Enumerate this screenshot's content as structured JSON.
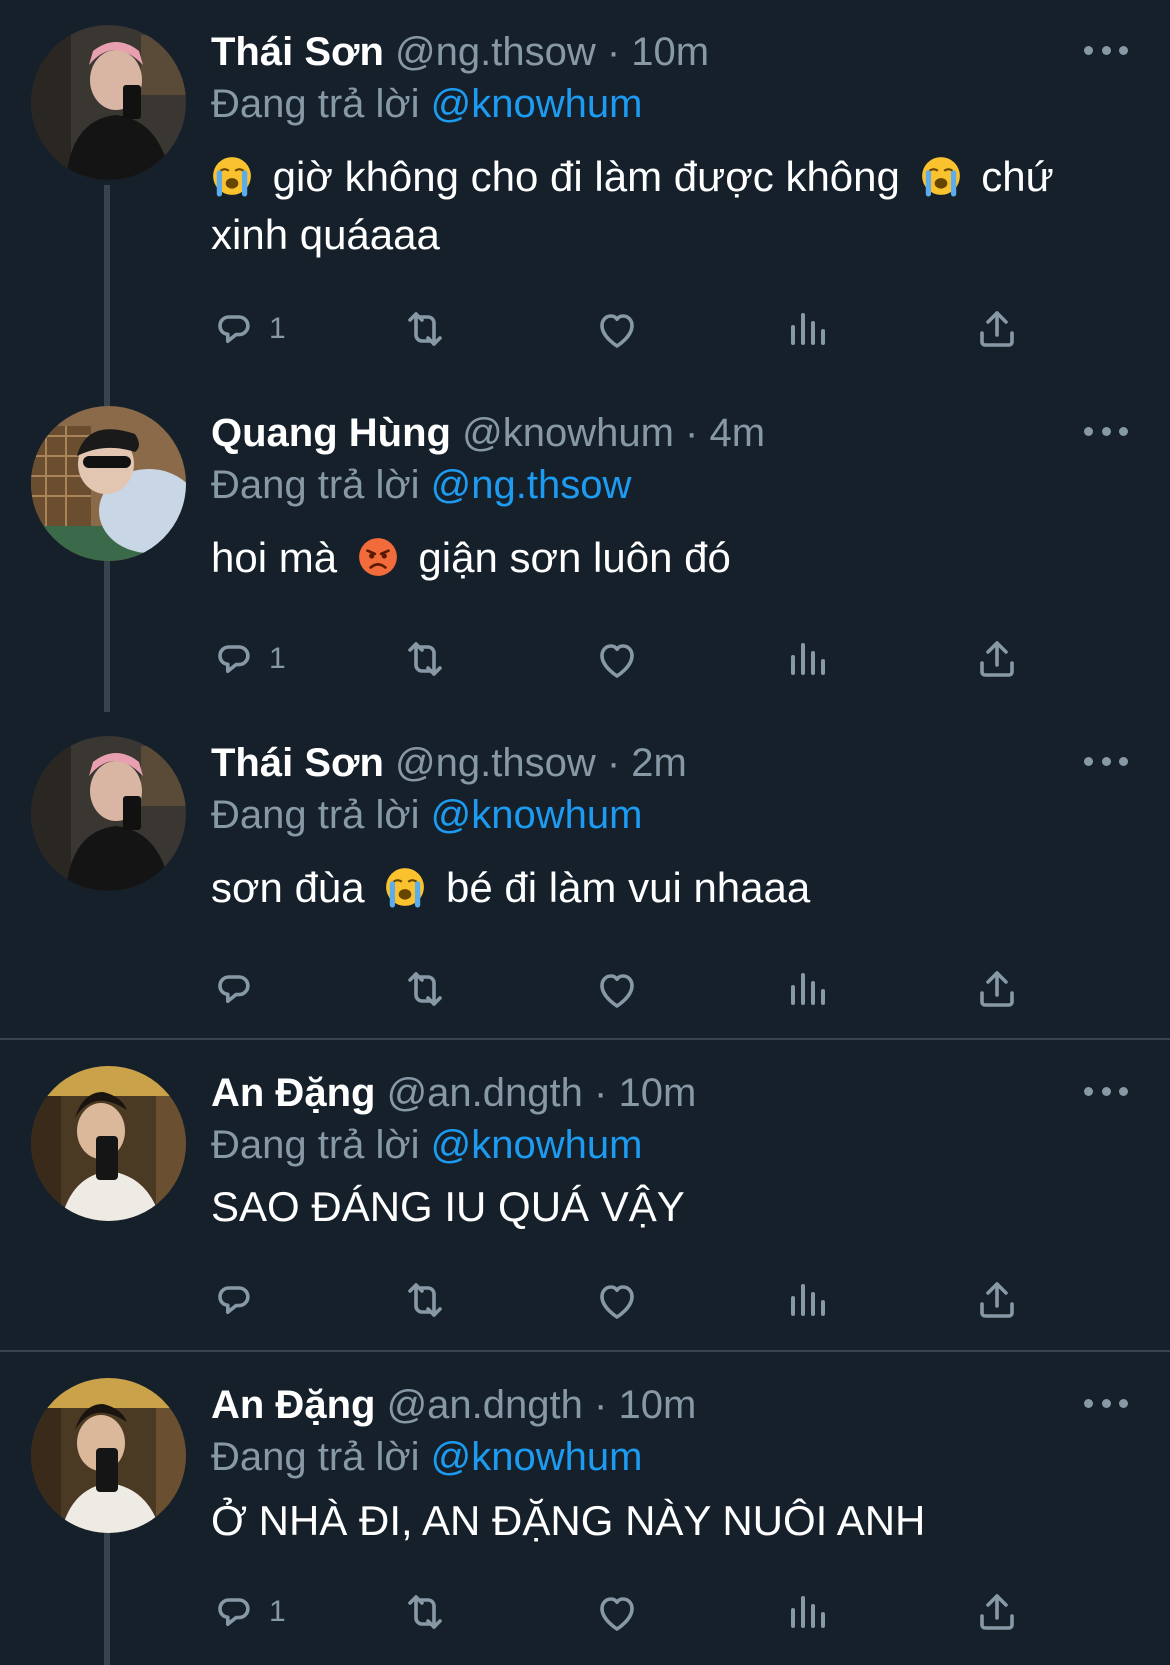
{
  "colors": {
    "background": "#15202b",
    "text": "#ffffff",
    "muted": "#8899a6",
    "link": "#1d9bf0",
    "divider": "#38444d"
  },
  "tweets": [
    {
      "name": "Thái Sơn",
      "handle": "@ng.thsow",
      "dot": "·",
      "time": "10m",
      "reply_label": "Đang trả lời",
      "reply_handle": "@knowhum",
      "text_parts": [
        "giờ không cho đi làm được không",
        "chứ",
        "xinh quáaaa"
      ],
      "emojis": [
        "loudly-crying-face",
        "loudly-crying-face"
      ],
      "reply_count": "1",
      "avatar": "avatar-thai-son"
    },
    {
      "name": "Quang Hùng",
      "handle": "@knowhum",
      "dot": "·",
      "time": "4m",
      "reply_label": "Đang trả lời",
      "reply_handle": "@ng.thsow",
      "text_parts": [
        "hoi mà",
        "giận sơn luôn đó"
      ],
      "emojis": [
        "angry-face"
      ],
      "reply_count": "1",
      "avatar": "avatar-quang-hung"
    },
    {
      "name": "Thái Sơn",
      "handle": "@ng.thsow",
      "dot": "·",
      "time": "2m",
      "reply_label": "Đang trả lời",
      "reply_handle": "@knowhum",
      "text_parts": [
        "sơn đùa",
        "bé đi làm vui nhaaa"
      ],
      "emojis": [
        "loudly-crying-face"
      ],
      "reply_count": "",
      "avatar": "avatar-thai-son"
    },
    {
      "name": "An Đặng",
      "handle": "@an.dngth",
      "dot": "·",
      "time": "10m",
      "reply_label": "Đang trả lời",
      "reply_handle": "@knowhum",
      "text_parts": [
        "SAO ĐÁNG IU QUÁ VẬY"
      ],
      "emojis": [],
      "reply_count": "",
      "avatar": "avatar-an-dang"
    },
    {
      "name": "An Đặng",
      "handle": "@an.dngth",
      "dot": "·",
      "time": "10m",
      "reply_label": "Đang trả lời",
      "reply_handle": "@knowhum",
      "text_parts": [
        "Ở NHÀ ĐI, AN ĐẶNG NÀY NUÔI ANH"
      ],
      "emojis": [],
      "reply_count": "1",
      "avatar": "avatar-an-dang"
    }
  ],
  "action_icons": [
    "reply-icon",
    "retweet-icon",
    "like-icon",
    "analytics-icon",
    "share-icon"
  ]
}
